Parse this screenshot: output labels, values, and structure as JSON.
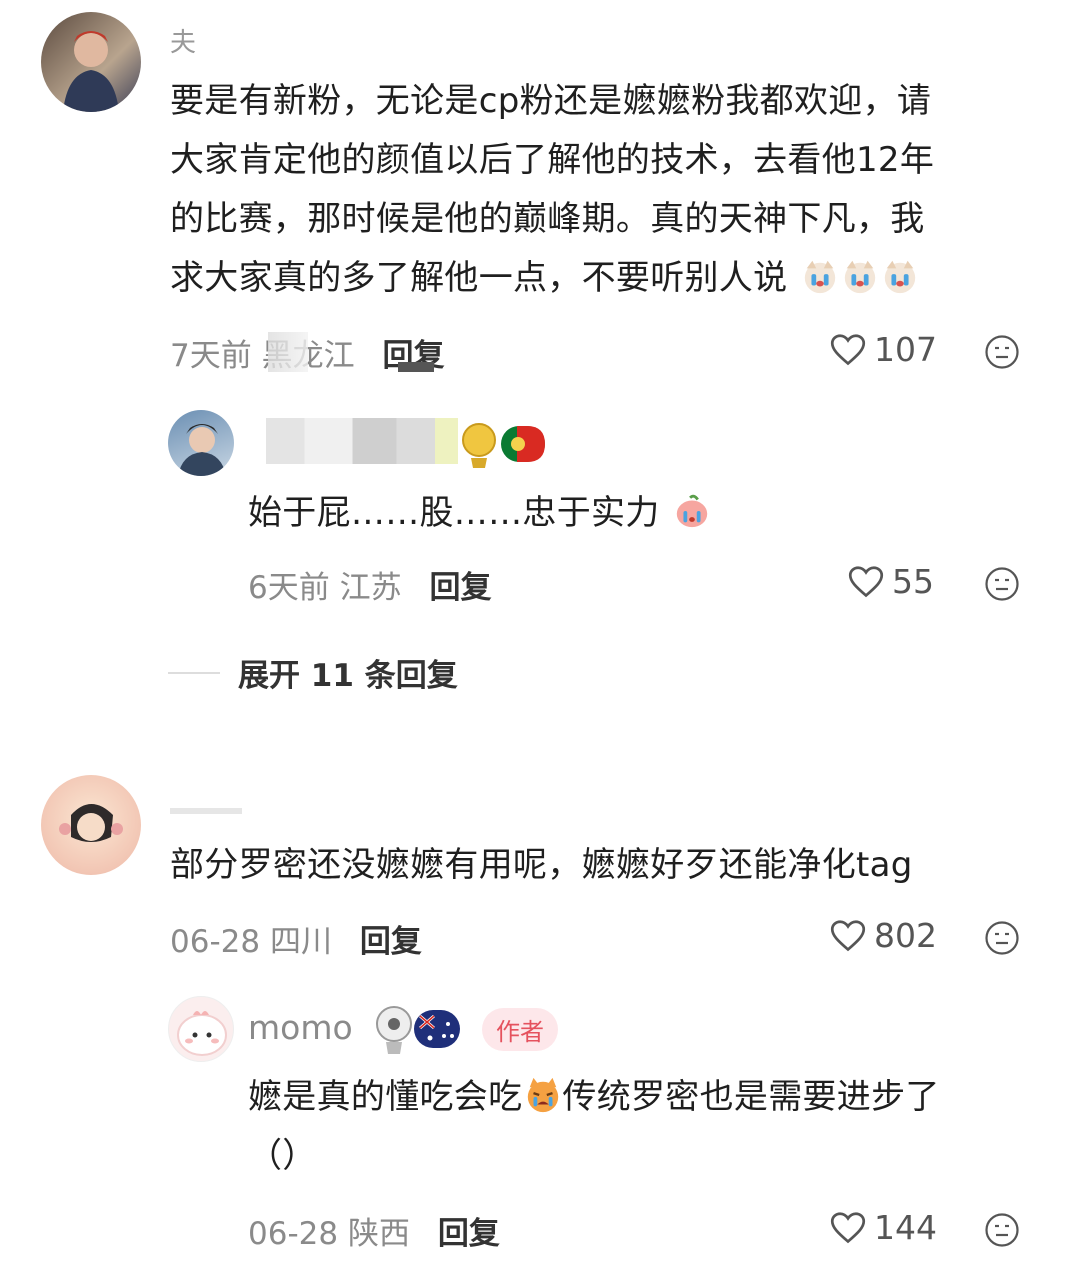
{
  "comments": [
    {
      "username": "夫",
      "text_lines": [
        "要是有新粉，无论是cp粉还是嬷嬷粉我都欢迎，请",
        "大家肯定他的颜值以后了解他的技术，去看他12年",
        "的比赛，那时候是他的巅峰期。真的天神下凡，我",
        "求大家真的多了解他一点，不要听别人说"
      ],
      "time": "7天前",
      "location": "黑龙江",
      "reply_label": "回复",
      "likes": "107",
      "reply": {
        "username": "",
        "text": "始于屁……股……忠于实力",
        "time": "6天前",
        "location": "江苏",
        "reply_label": "回复",
        "likes": "55"
      },
      "expand_label": "展开 11 条回复"
    },
    {
      "username": "",
      "text_lines": [
        "部分罗密还没嬷嬷有用呢，嬷嬷好歹还能净化tag"
      ],
      "time": "06-28",
      "location": "四川",
      "reply_label": "回复",
      "likes": "802",
      "reply": {
        "username": "momo",
        "author_badge": "作者",
        "text_lines": [
          "嬷是真的懂吃会吃",
          "传统罗密也是需要进步了",
          "（）"
        ],
        "time": "06-28",
        "location": "陕西",
        "reply_label": "回复",
        "likes": "144"
      }
    }
  ]
}
